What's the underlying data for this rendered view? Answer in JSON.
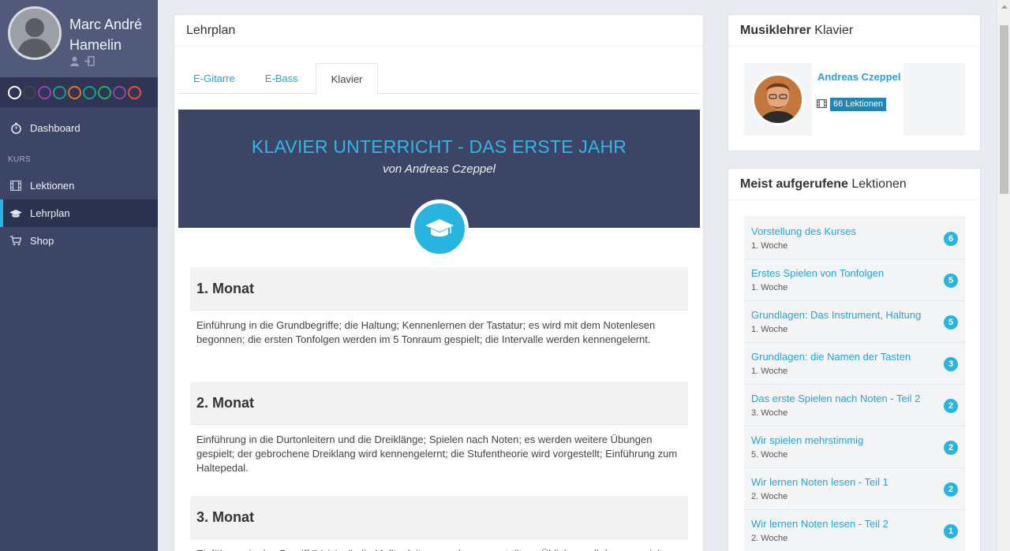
{
  "user": {
    "name": "Marc André Hamelin"
  },
  "theme_colors": [
    "#ffffff",
    "#444444",
    "#a13fb0",
    "#1f9a8e",
    "#e07724",
    "#16a085",
    "#27ae60",
    "#8e44ad",
    "#e74c3c"
  ],
  "sidebar": {
    "dashboard_label": "Dashboard",
    "section_label": "KURS",
    "items": [
      {
        "label": "Lektionen",
        "icon": "film-icon"
      },
      {
        "label": "Lehrplan",
        "icon": "graduation-cap-icon"
      },
      {
        "label": "Shop",
        "icon": "cart-icon"
      }
    ]
  },
  "main": {
    "title": "Lehrplan",
    "tabs": [
      {
        "label": "E-Gitarre"
      },
      {
        "label": "E-Bass"
      },
      {
        "label": "Klavier"
      }
    ],
    "hero": {
      "title": "KLAVIER UNTERRICHT - DAS ERSTE JAHR",
      "subtitle": "von Andreas Czeppel"
    },
    "months": [
      {
        "title": "1. Monat",
        "text": "Einführung in die Grundbegriffe; die Haltung; Kennenlernen der Tastatur; es wird mit dem Notenlesen begonnen; die ersten Tonfolgen werden im 5 Tonraum gespielt; die Intervalle werden kennengelernt."
      },
      {
        "title": "2. Monat",
        "text": "Einführung in die Durtonleitern und die Dreiklänge; Spielen nach Noten; es werden weitere Übungen gespielt; der gebrochene Dreiklang wird kennengelernt; die Stufentheorie wird vorgestellt; Einführung zum Haltepedal."
      },
      {
        "title": "3. Monat",
        "text": "Einführung in den Begriff \"Voicing\"; die Molltonleitern werden vorgestellt; es Übliches soll dann gespielt"
      }
    ]
  },
  "teacher_panel": {
    "title_bold": "Musiklehrer",
    "title_rest": "Klavier",
    "name": "Andreas Czeppel",
    "lessons_badge": "66 Lektionen"
  },
  "lessons_panel": {
    "title_bold": "Meist aufgerufene",
    "title_rest": "Lektionen",
    "items": [
      {
        "title": "Vorstellung des Kurses",
        "week": "1. Woche",
        "count": "6"
      },
      {
        "title": "Erstes Spielen von Tonfolgen",
        "week": "1. Woche",
        "count": "5"
      },
      {
        "title": "Grundlagen: Das Instrument, Haltung",
        "week": "1. Woche",
        "count": "5"
      },
      {
        "title": "Grundlagen: die Namen der Tasten",
        "week": "1. Woche",
        "count": "3"
      },
      {
        "title": "Das erste Spielen nach Noten - Teil 2",
        "week": "3. Woche",
        "count": "2"
      },
      {
        "title": "Wir spielen mehrstimmig",
        "week": "5. Woche",
        "count": "2"
      },
      {
        "title": "Wir lernen Noten lesen - Teil 1",
        "week": "2. Woche",
        "count": "2"
      },
      {
        "title": "Wir lernen Noten lesen - Teil 2",
        "week": "2. Woche",
        "count": "1"
      }
    ]
  }
}
